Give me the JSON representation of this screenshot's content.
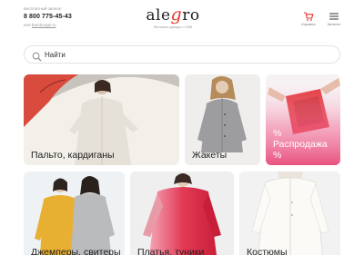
{
  "header": {
    "contact_label": "Бесплатный звонок:",
    "phone": "8 800 775-45-43",
    "site_prefix": "или",
    "site_link": "bambooge.ru",
    "logo_text_left": "ale",
    "logo_text_accent": "g",
    "logo_text_right": "ro",
    "logo_tagline": "Женская одежда с 1998",
    "cart_label": "Корзина",
    "menu_label": "Каталог"
  },
  "search": {
    "placeholder": "Найти"
  },
  "categories": [
    {
      "label": "Пальто, кардиганы"
    },
    {
      "label": "Жакеты"
    },
    {
      "label": "% Распродажа %"
    },
    {
      "label": "Джемперы, свитеры"
    },
    {
      "label": "Платья, туники"
    },
    {
      "label": "Костюмы"
    }
  ],
  "colors": {
    "brand_accent": "#e8352b",
    "sale_pink": "#e94a7a"
  }
}
